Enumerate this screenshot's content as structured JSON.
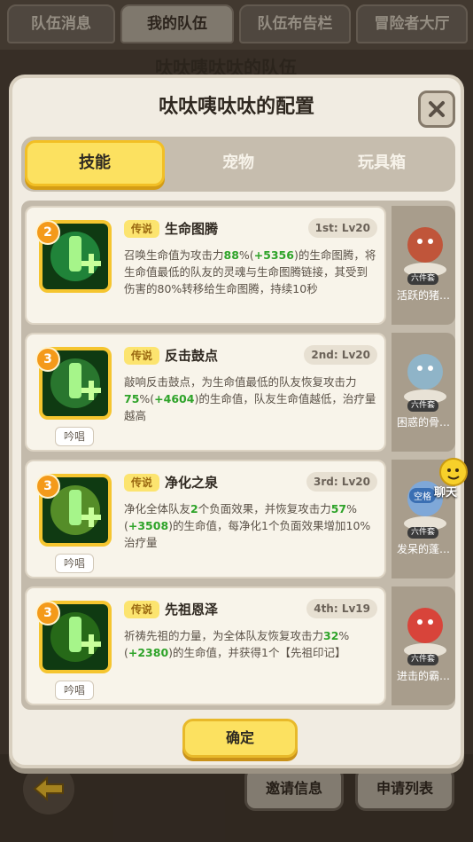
{
  "background": {
    "tabs": [
      "队伍消息",
      "我的队伍",
      "队伍布告栏",
      "冒险者大厅"
    ],
    "team_title": "呔呔咦呔呔的队伍",
    "buttons": {
      "invite": "邀请信息",
      "apply": "申请列表"
    }
  },
  "modal": {
    "title": "呔呔咦呔呔的配置",
    "tabs": [
      "技能",
      "宠物",
      "玩具箱"
    ],
    "confirm_label": "确定"
  },
  "skills": [
    {
      "level_badge": "2",
      "tag": "传说",
      "name": "生命图腾",
      "slot": "1st: Lv20",
      "chant": "",
      "desc": [
        {
          "t": "召唤生命值为攻击力"
        },
        {
          "t": "88",
          "g": true
        },
        {
          "t": "%("
        },
        {
          "t": "+5356",
          "g": true
        },
        {
          "t": ")的生命图腾，将生命值最低的队友的灵魂与生命图腾链接，其受到伤害的80%转移给生命图腾，持续10秒"
        }
      ],
      "pet_name": "活跃的猪…",
      "icon_color": "#2fbf5a"
    },
    {
      "level_badge": "3",
      "tag": "传说",
      "name": "反击鼓点",
      "slot": "2nd: Lv20",
      "chant": "吟唱",
      "desc": [
        {
          "t": "敲响反击鼓点，为生命值最低的队友恢复攻击力"
        },
        {
          "t": "75",
          "g": true
        },
        {
          "t": "%("
        },
        {
          "t": "+4604",
          "g": true
        },
        {
          "t": ")的生命值，队友生命值越低，治疗量越高"
        }
      ],
      "pet_name": "困惑的骨…",
      "icon_color": "#3fa845"
    },
    {
      "level_badge": "3",
      "tag": "传说",
      "name": "净化之泉",
      "slot": "3rd: Lv20",
      "chant": "吟唱",
      "desc": [
        {
          "t": "净化全体队友"
        },
        {
          "t": "2",
          "g": true
        },
        {
          "t": "个负面效果，并恢复攻击力"
        },
        {
          "t": "57",
          "g": true
        },
        {
          "t": "%("
        },
        {
          "t": "+3508",
          "g": true
        },
        {
          "t": ")的生命值，每净化1个负面效果增加10%治疗量"
        }
      ],
      "pet_name": "发呆的蓬…",
      "icon_color": "#8fd13a"
    },
    {
      "level_badge": "3",
      "tag": "传说",
      "name": "先祖恩泽",
      "slot": "4th: Lv19",
      "chant": "吟唱",
      "desc": [
        {
          "t": "祈祷先祖的力量，为全体队友恢复攻击力"
        },
        {
          "t": "32",
          "g": true
        },
        {
          "t": "%("
        },
        {
          "t": "+2380",
          "g": true
        },
        {
          "t": ")的生命值，并获得1个【先祖印记】"
        }
      ],
      "pet_name": "进击的霸…",
      "icon_color": "#3b8f1e"
    }
  ],
  "pet_rank": "六件套",
  "pet_empty_label": "空格",
  "chat_label": "聊天",
  "colors": {
    "accent": "#fce160",
    "highlight_green": "#2ea329"
  }
}
